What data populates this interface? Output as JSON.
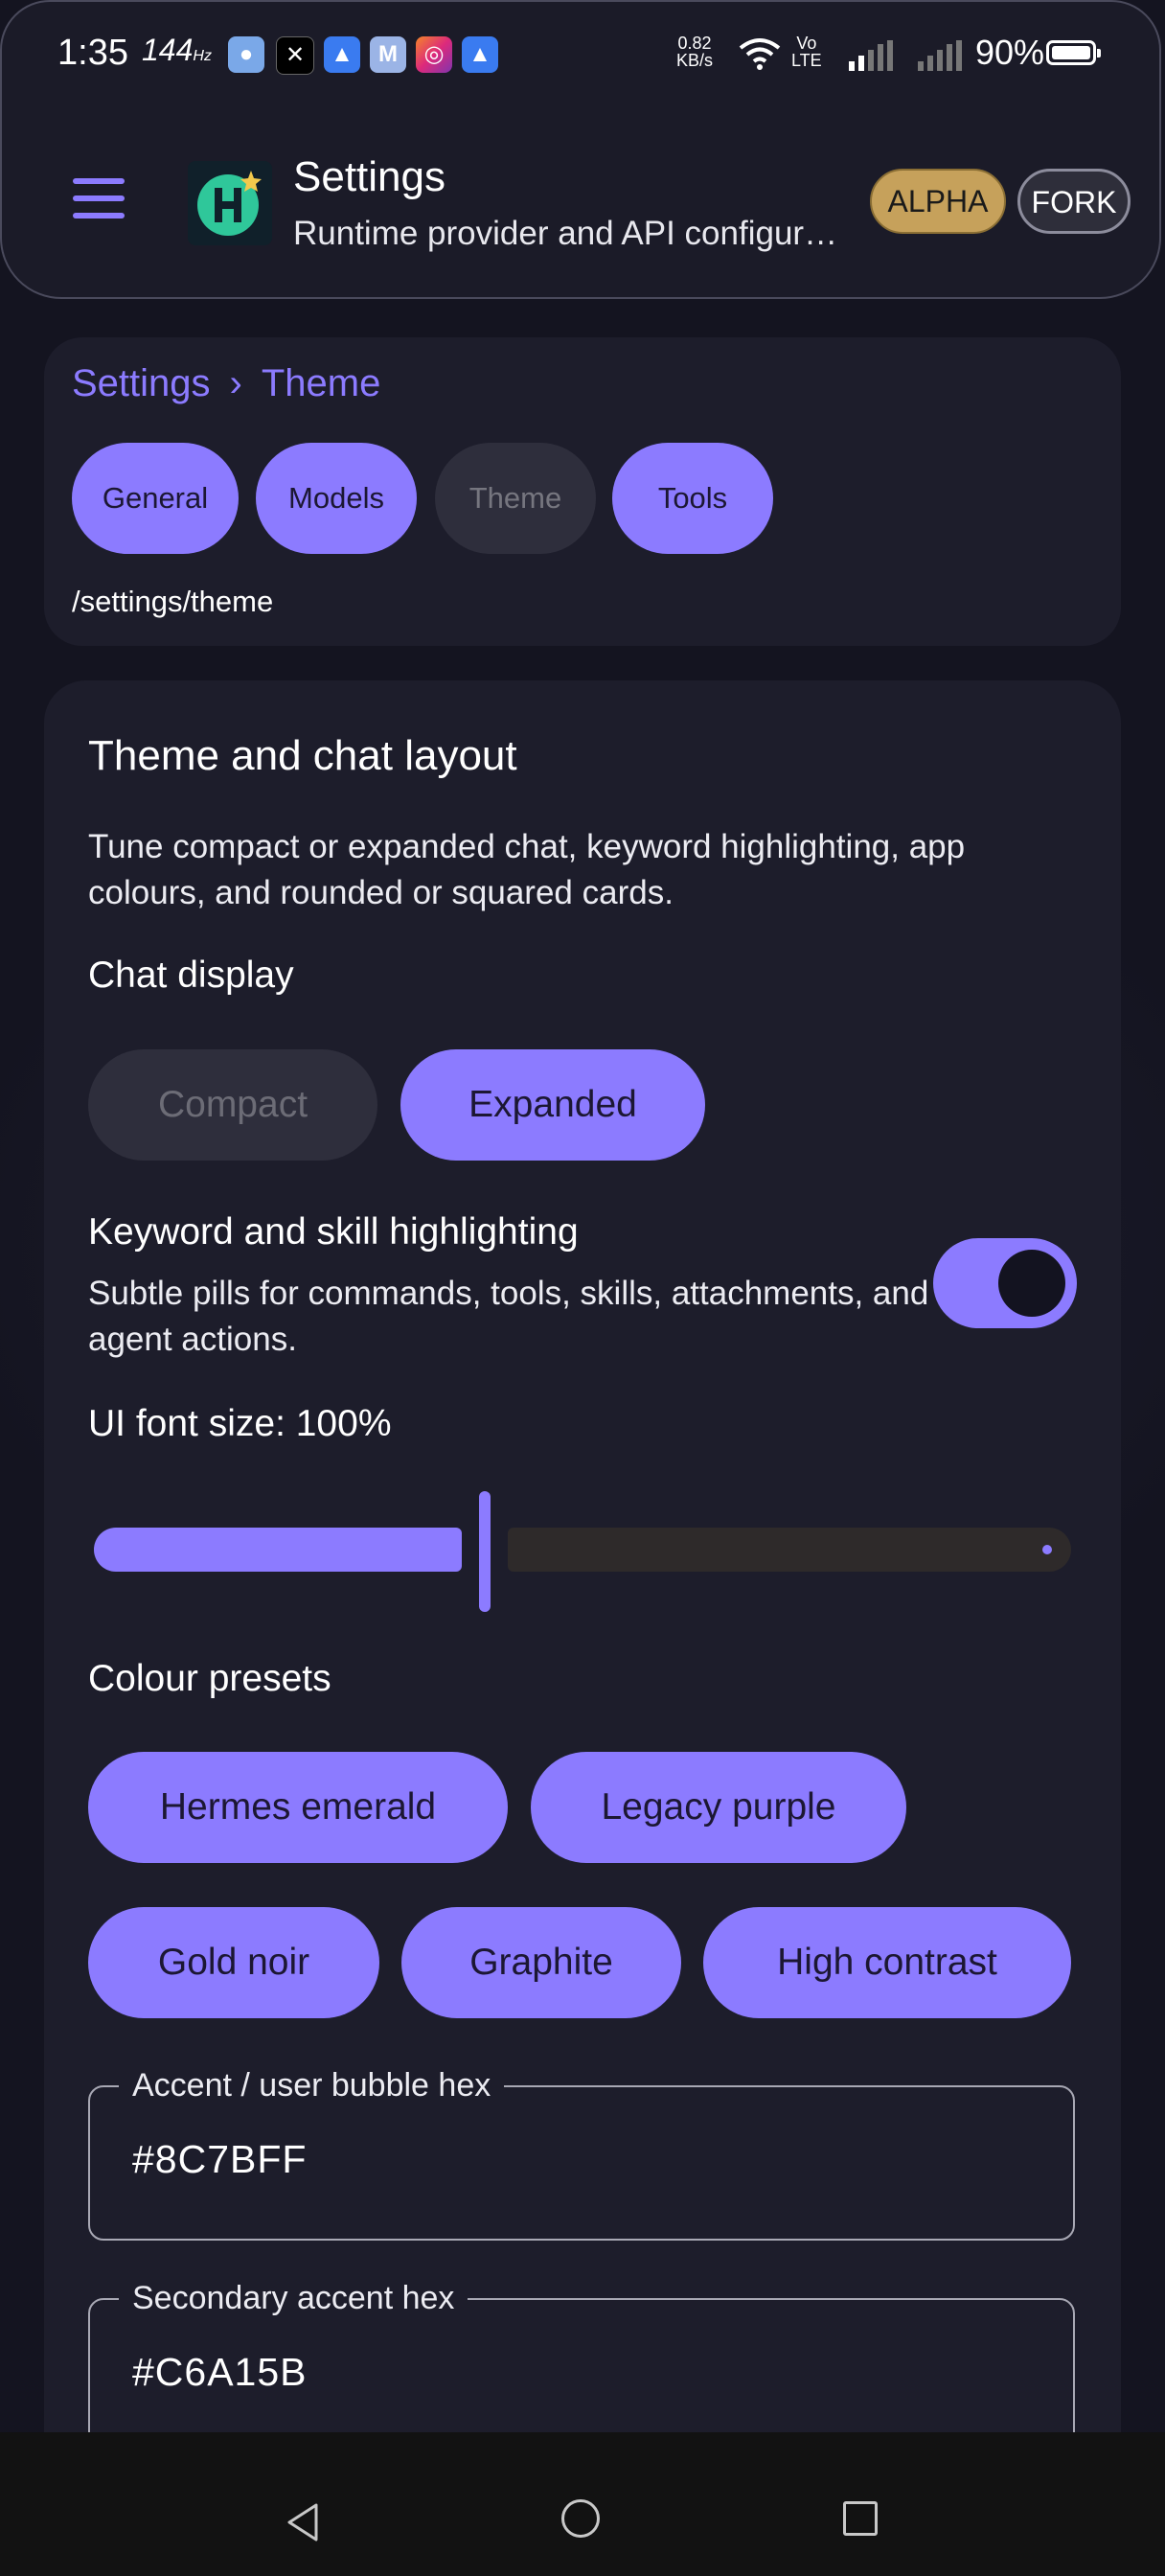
{
  "status_bar": {
    "time": "1:35",
    "refresh": "144",
    "refresh_unit": "Hz",
    "net_speed": "0.82",
    "net_unit": "KB/s",
    "volte_top": "Vo",
    "volte_bottom": "LTE",
    "battery": "90%",
    "notification_icons": [
      "chat-icon",
      "x-icon",
      "alert-icon",
      "gmail-icon",
      "instagram-icon",
      "alert-icon"
    ]
  },
  "header": {
    "title": "Settings",
    "subtitle": "Runtime provider and API configuration",
    "badge_alpha": "ALPHA",
    "badge_fork": "FORK"
  },
  "breadcrumb": {
    "root": "Settings",
    "separator": "›",
    "current": "Theme"
  },
  "tabs": [
    {
      "label": "General",
      "active": true
    },
    {
      "label": "Models",
      "active": true
    },
    {
      "label": "Theme",
      "active": false
    },
    {
      "label": "Tools",
      "active": true
    }
  ],
  "route": "/settings/theme",
  "theme_card": {
    "title": "Theme and chat layout",
    "description": "Tune compact or expanded chat, keyword highlighting, app colours, and rounded or squared cards.",
    "chat_display": {
      "label": "Chat display",
      "options": [
        "Compact",
        "Expanded"
      ],
      "selected": "Expanded"
    },
    "keyword_highlighting": {
      "label": "Keyword and skill highlighting",
      "description": "Subtle pills for commands, tools, skills, attachments, and agent actions.",
      "enabled": true
    },
    "font_size": {
      "label": "UI font size: 100%",
      "value_fraction": 0.38
    },
    "colour_presets": {
      "label": "Colour presets",
      "options": [
        "Hermes emerald",
        "Legacy purple",
        "Gold noir",
        "Graphite",
        "High contrast"
      ]
    },
    "accent_field": {
      "label": "Accent / user bubble hex",
      "value": "#8C7BFF"
    },
    "secondary_field": {
      "label": "Secondary accent hex",
      "value": "#C6A15B"
    }
  },
  "colors": {
    "accent": "#8C7BFF",
    "secondary": "#C6A15B",
    "card": "#1D1D2B"
  }
}
